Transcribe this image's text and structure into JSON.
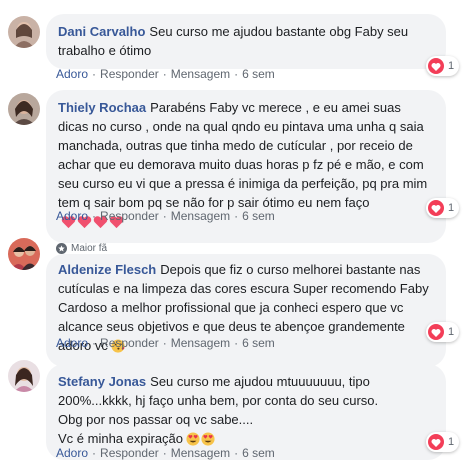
{
  "comments": [
    {
      "author": "Dani Carvalho",
      "text": "Seu curso me ajudou bastante obg Faby seu trabalho e ótimo",
      "actions": {
        "love": "Adoro",
        "reply": "Responder",
        "message": "Mensagem",
        "time": "6 sem"
      },
      "reaction_count": "1"
    },
    {
      "author": "Thiely Rochaa",
      "text": "Parabéns Faby vc merece , e eu amei suas dicas no curso , onde na qual qndo eu pintava uma unha q saia manchada, outras que tinha medo de cutícular , por receio de achar que eu demorava muito duas horas p fz pé e mão, e com seu curso eu vi que a pressa é inimiga da perfeição, pq pra mim tem q sair bom pq se não for p sair ótimo eu nem faço",
      "actions": {
        "love": "Adoro",
        "reply": "Responder",
        "message": "Mensagem",
        "time": "6 sem"
      },
      "reaction_count": "1"
    },
    {
      "badge_label": "Maior fã",
      "author": "Aldenize Flesch",
      "text": "Depois que fiz o curso melhorei bastante nas cutículas e na limpeza das cores escura Super recomendo Faby Cardoso a melhor profissional que ja conheci espero que vc alcance seus objetivos e que deus te abençoe grandemente adoro vc",
      "actions": {
        "love": "Adoro",
        "reply": "Responder",
        "message": "Mensagem",
        "time": "6 sem"
      },
      "reaction_count": "1"
    },
    {
      "author": "Stefany Jonas",
      "text": "Seu curso me ajudou mtuuuuuuu, tipo 200%...kkkk, hj faço unha bem, por conta do seu curso.\nObg por nos passar oq vc sabe....\nVc é minha expiração",
      "actions": {
        "love": "Adoro",
        "reply": "Responder",
        "message": "Mensagem",
        "time": "6 sem"
      },
      "reaction_count": "1"
    }
  ],
  "colors": {
    "author": "#385898",
    "bubble": "#f2f3f5",
    "heart": "#f33e58",
    "meta": "#606770"
  },
  "icons": {
    "reaction": "heart-icon",
    "fan": "star-badge-icon",
    "emoji_kiss": "kiss-emoji-icon",
    "emoji_heart_eyes": "heart-eyes-emoji-icon"
  }
}
